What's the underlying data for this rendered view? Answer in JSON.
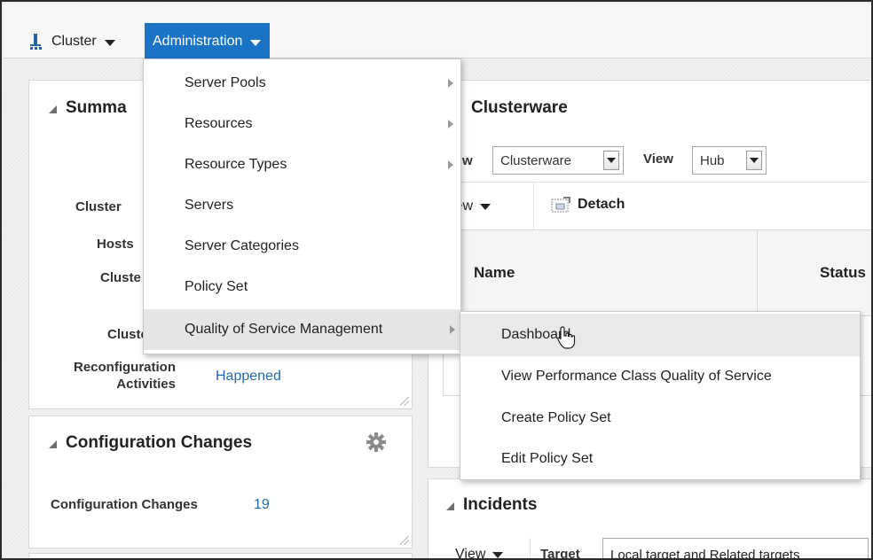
{
  "toolbar": {
    "cluster_label": "Cluster",
    "administration_label": "Administration"
  },
  "summary_panel": {
    "title": "Summa",
    "rows": [
      {
        "label": "Cluster"
      },
      {
        "label": "Hosts"
      },
      {
        "label": "Cluste"
      },
      {
        "label": "Cluste"
      }
    ],
    "reconfig_label_line1": "Reconfiguration",
    "reconfig_label_line2": "Activities",
    "reconfig_value": "Happened"
  },
  "config_panel": {
    "title": "Configuration Changes",
    "label": "Configuration Changes",
    "value": "19"
  },
  "clusterware_panel": {
    "title": "Clusterware",
    "view_label_partial": "w",
    "view_select_value": "Clusterware",
    "view_label": "View",
    "hub_select_value": "Hub",
    "view_menu_partial": "iew",
    "detach_label": "Detach",
    "columns": [
      "Name",
      "Status"
    ]
  },
  "incidents_panel": {
    "title": "Incidents",
    "view_label": "View",
    "target_label": "Target",
    "target_value": "Local target and Related targets"
  },
  "administration_menu": {
    "items": [
      {
        "label": "Server Pools",
        "has_submenu": true
      },
      {
        "label": "Resources",
        "has_submenu": true
      },
      {
        "label": "Resource Types",
        "has_submenu": true
      },
      {
        "label": "Servers",
        "has_submenu": false
      },
      {
        "label": "Server Categories",
        "has_submenu": false
      },
      {
        "label": "Policy Set",
        "has_submenu": false
      },
      {
        "label": "Quality of Service Management",
        "has_submenu": true,
        "active": true
      }
    ]
  },
  "qos_submenu": {
    "items": [
      {
        "label": "Dashboard",
        "hovered": true
      },
      {
        "label": "View Performance Class Quality of Service"
      },
      {
        "label": "Create Policy Set"
      },
      {
        "label": "Edit Policy Set"
      }
    ]
  },
  "colors": {
    "accent": "#1b73c6",
    "link": "#1f6ab3",
    "menu_hover": "#e6e6e6"
  }
}
